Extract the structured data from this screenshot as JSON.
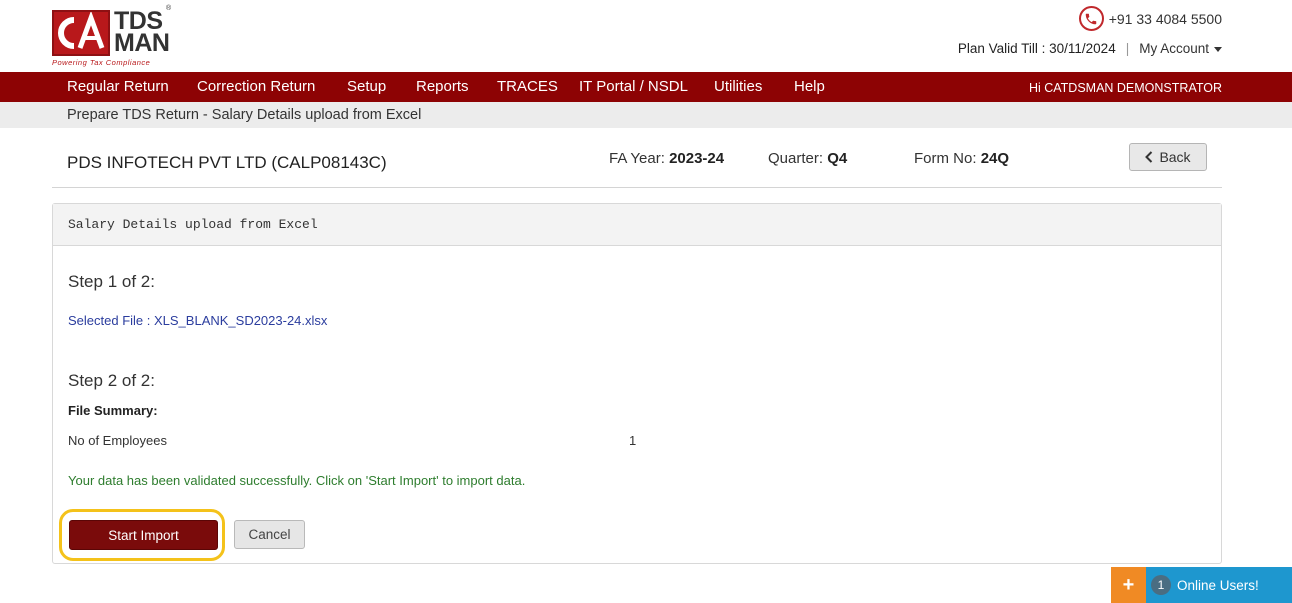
{
  "brand": {
    "logo_left": "CA",
    "logo_line1": "TDS",
    "logo_line2": "MAN",
    "tagline": "Powering Tax Compliance",
    "registered": "®"
  },
  "header": {
    "phone": "+91 33 4084 5500",
    "plan_valid": "Plan Valid Till : 30/11/2024",
    "separator": "|",
    "my_account": "My Account"
  },
  "nav": {
    "items": [
      {
        "label": "Regular Return"
      },
      {
        "label": "Correction Return"
      },
      {
        "label": "Setup"
      },
      {
        "label": "Reports"
      },
      {
        "label": "TRACES"
      },
      {
        "label": "IT Portal / NSDL"
      },
      {
        "label": "Utilities"
      },
      {
        "label": "Help"
      }
    ],
    "greeting": "Hi CATDSMAN DEMONSTRATOR"
  },
  "breadcrumb": "Prepare TDS Return - Salary Details upload from Excel",
  "info": {
    "company": "PDS INFOTECH PVT LTD (CALP08143C)",
    "fa_label": "FA Year:",
    "fa_value": "2023-24",
    "quarter_label": "Quarter:",
    "quarter_value": "Q4",
    "form_label": "Form No:",
    "form_value": "24Q",
    "back_label": "Back"
  },
  "panel": {
    "title": "Salary Details upload from Excel",
    "step1": "Step 1 of 2:",
    "selected_file": "Selected File : XLS_BLANK_SD2023-24.xlsx",
    "step2": "Step 2 of 2:",
    "file_summary": "File Summary:",
    "employees_label": "No of Employees",
    "employees_value": "1",
    "success_msg": "Your data has been validated successfully. Click on 'Start Import' to import data.",
    "start_import": "Start Import",
    "cancel": "Cancel"
  },
  "online_widget": {
    "plus": "+",
    "count": "1",
    "label": "Online Users!"
  },
  "colors": {
    "nav_bg": "#8d0304",
    "brand_red": "#b8181b",
    "start_button": "#7a0b0b",
    "highlight": "#f4c21a",
    "success_text": "#2e7d2e",
    "link_text": "#2b3d9e",
    "online_blue": "#1e97cf",
    "online_orange": "#f08a24"
  },
  "icons": {
    "phone": "phone-icon",
    "account_caret": "caret-down-icon",
    "back": "chevron-left-icon",
    "plus": "plus-icon"
  }
}
